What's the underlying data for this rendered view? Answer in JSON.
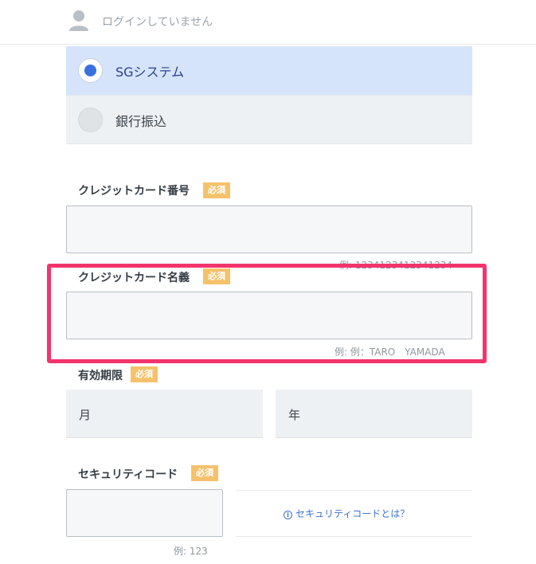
{
  "header": {
    "login_status": "ログインしていません"
  },
  "payment_methods": [
    {
      "label": "SGシステム",
      "selected": true
    },
    {
      "label": "銀行振込",
      "selected": false
    }
  ],
  "required_badge": "必須",
  "card_number": {
    "label": "クレジットカード番号",
    "hint": "例: 1234123412341234"
  },
  "card_name": {
    "label": "クレジットカード名義",
    "hint": "例: 例：TARO　YAMADA"
  },
  "expiry": {
    "label": "有効期限",
    "month": "月",
    "year": "年"
  },
  "security_code": {
    "label": "セキュリティコード",
    "hint": "例: 123",
    "help_link": "セキュリティコードとは？",
    "help_icon": "i"
  },
  "colors": {
    "accent": "#3a6fe0",
    "badge": "#f5c26b",
    "highlight": "#f2346d",
    "link": "#3a72d6"
  }
}
